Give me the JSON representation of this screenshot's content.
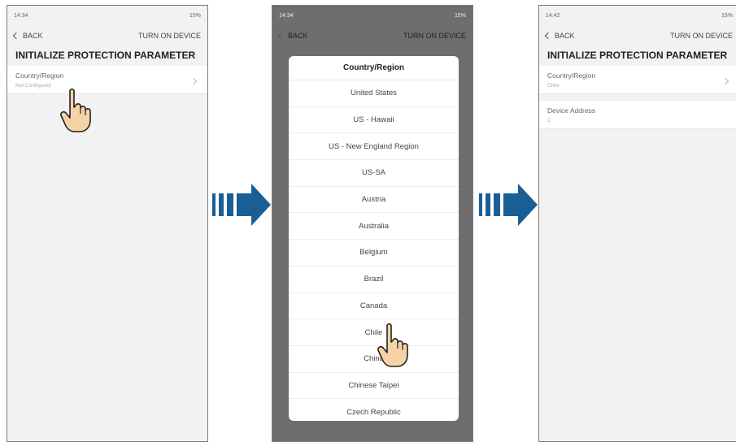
{
  "screen1": {
    "status_time": "14:34",
    "status_right": "15%",
    "back_label": "BACK",
    "turn_on_label": "TURN ON DEVICE",
    "page_title": "INITIALIZE PROTECTION PARAMETER",
    "country_label": "Country/Region",
    "country_value": "Not Configured"
  },
  "screen2": {
    "status_time": "14:34",
    "status_right": "15%",
    "back_label": "BACK",
    "turn_on_label": "TURN ON DEVICE",
    "dialog_title": "Country/Region",
    "options": [
      "United States",
      "US - Hawaii",
      "US - New England Region",
      "US-SA",
      "Austria",
      "Australia",
      "Belgium",
      "Brazil",
      "Canada",
      "Chile",
      "China",
      "Chinese Taipei",
      "Czech Republic"
    ]
  },
  "screen3": {
    "status_time": "14:42",
    "status_right": "15%",
    "back_label": "BACK",
    "turn_on_label": "TURN ON DEVICE",
    "page_title": "INITIALIZE PROTECTION PARAMETER",
    "country_label": "Country/Region",
    "country_value": "Chile",
    "device_address_label": "Device Address",
    "device_address_value": "1"
  },
  "colors": {
    "arrow": "#1a5e96",
    "hand_fill": "#f6d3a6",
    "dim_overlay": "#6e6e6e"
  },
  "icons": {
    "pointer": "hand-pointer-icon",
    "flow": "next-step-arrow-icon"
  }
}
